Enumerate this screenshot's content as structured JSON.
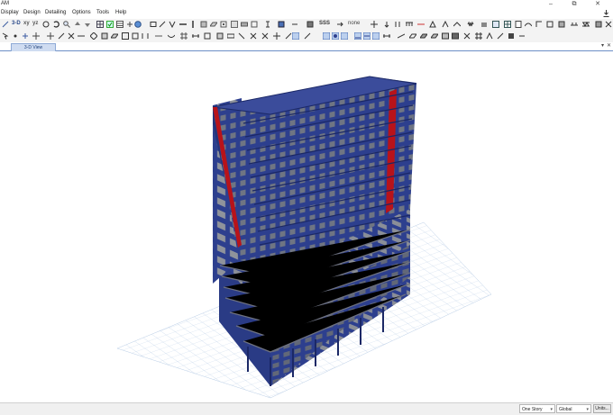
{
  "window": {
    "title": "AM",
    "controls": {
      "minimize": "–",
      "maximize": "⧉",
      "close": "✕"
    }
  },
  "menu": {
    "items": [
      "Display",
      "Design",
      "Detailing",
      "Options",
      "Tools",
      "Help"
    ]
  },
  "toolbar": {
    "row1_text_3d": "3-D",
    "row1_text_xy": "xy",
    "row1_text_yz": "yz",
    "row1_text_sss": "SSS",
    "row1_text_none": "none"
  },
  "tabs": [
    {
      "label": "3-D View"
    }
  ],
  "tab_close": "✕",
  "statusbar": {
    "story_select": "One Story",
    "coord_select": "Global",
    "units_button": "Units..."
  },
  "colors": {
    "frame": "#2d3f8e",
    "frame_dark": "#1b2866",
    "slab": "#9a9a9a",
    "wall_red": "#b8131a",
    "grid": "#b9cde6"
  }
}
